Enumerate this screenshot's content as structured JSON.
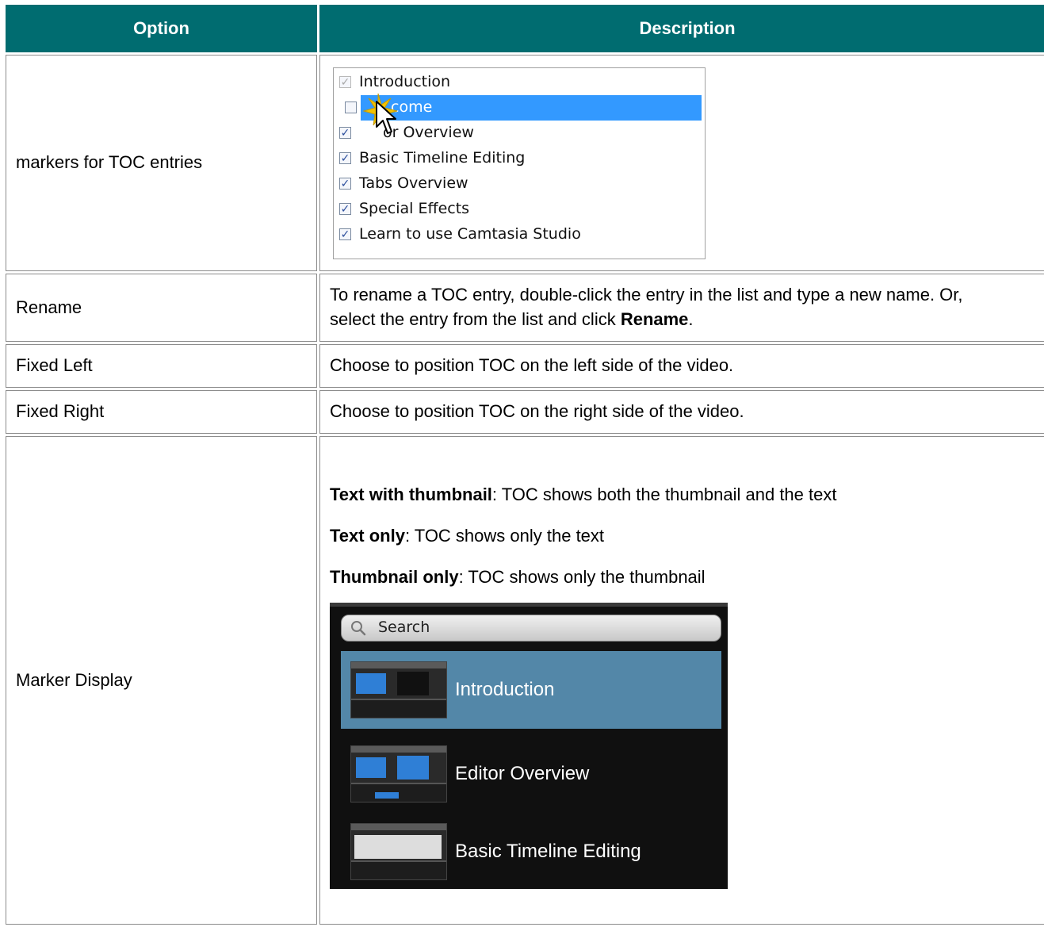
{
  "table": {
    "headers": {
      "option": "Option",
      "description": "Description"
    },
    "rows": {
      "markers": {
        "option": "markers for TOC entries",
        "toc_list": [
          {
            "label": "Introduction",
            "checked": true,
            "dimmed": true
          },
          {
            "label": "come",
            "checked": false,
            "selected": true
          },
          {
            "label": "or Overview",
            "checked": true
          },
          {
            "label": "Basic Timeline Editing",
            "checked": true
          },
          {
            "label": "Tabs Overview",
            "checked": true
          },
          {
            "label": "Special Effects",
            "checked": true
          },
          {
            "label": "Learn to use Camtasia Studio",
            "checked": true
          }
        ]
      },
      "rename": {
        "option": "Rename",
        "desc_line1": "To rename a TOC entry, double-click the entry in the list and type a new name. Or,",
        "desc_line2_pre": "select the entry from the list and click ",
        "desc_line2_bold": "Rename",
        "desc_line2_post": "."
      },
      "fixed_left": {
        "option": "Fixed Left",
        "description": "Choose to position TOC on the left side of the video."
      },
      "fixed_right": {
        "option": "Fixed Right",
        "description": "Choose to position TOC on the right side of the video."
      },
      "marker_display": {
        "option": "Marker Display",
        "modes": [
          {
            "bold": "Text with thumbnail",
            "rest": ": TOC shows both the thumbnail and the text"
          },
          {
            "bold": "Text only",
            "rest": ": TOC shows only the text"
          },
          {
            "bold": "Thumbnail only",
            "rest": ": TOC shows only the thumbnail"
          }
        ],
        "preview": {
          "search_placeholder": "Search",
          "entries": [
            "Introduction",
            "Editor Overview",
            "Basic Timeline Editing"
          ]
        }
      }
    }
  },
  "colors": {
    "header_bg": "#006c70",
    "header_text": "#ffffff",
    "selection": "#3399ff",
    "active_entry": "#5387a8"
  }
}
